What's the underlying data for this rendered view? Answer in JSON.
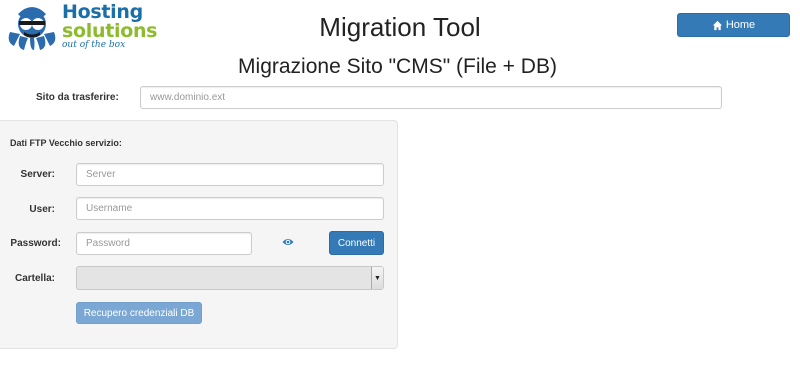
{
  "header": {
    "logo": {
      "line1": "Hosting",
      "line2": "solutions",
      "tagline": "out of the box"
    },
    "app_title": "Migration Tool",
    "home_button": {
      "label": "Home",
      "icon": "home-icon"
    }
  },
  "page": {
    "subtitle": "Migrazione Sito \"CMS\" (File + DB)",
    "site_field": {
      "label": "Sito da trasferire:",
      "placeholder": "www.dominio.ext",
      "value": ""
    }
  },
  "ftp_panel": {
    "title": "Dati FTP Vecchio servizio:",
    "server": {
      "label": "Server:",
      "placeholder": "Server",
      "value": ""
    },
    "user": {
      "label": "User:",
      "placeholder": "Username",
      "value": ""
    },
    "password": {
      "label": "Password:",
      "placeholder": "Password",
      "value": "",
      "toggle_icon": "eye-icon"
    },
    "connect_button": "Connetti",
    "folder": {
      "label": "Cartella:",
      "selected": "",
      "disabled": true
    },
    "recover_button": {
      "label": "Recupero credenziali DB",
      "disabled": true
    }
  },
  "colors": {
    "primary": "#337ab7",
    "primary_disabled": "#7aa7d3",
    "logo_blue": "#1a6fa8",
    "logo_green": "#8dbb2f",
    "panel_bg": "#f5f5f5"
  }
}
